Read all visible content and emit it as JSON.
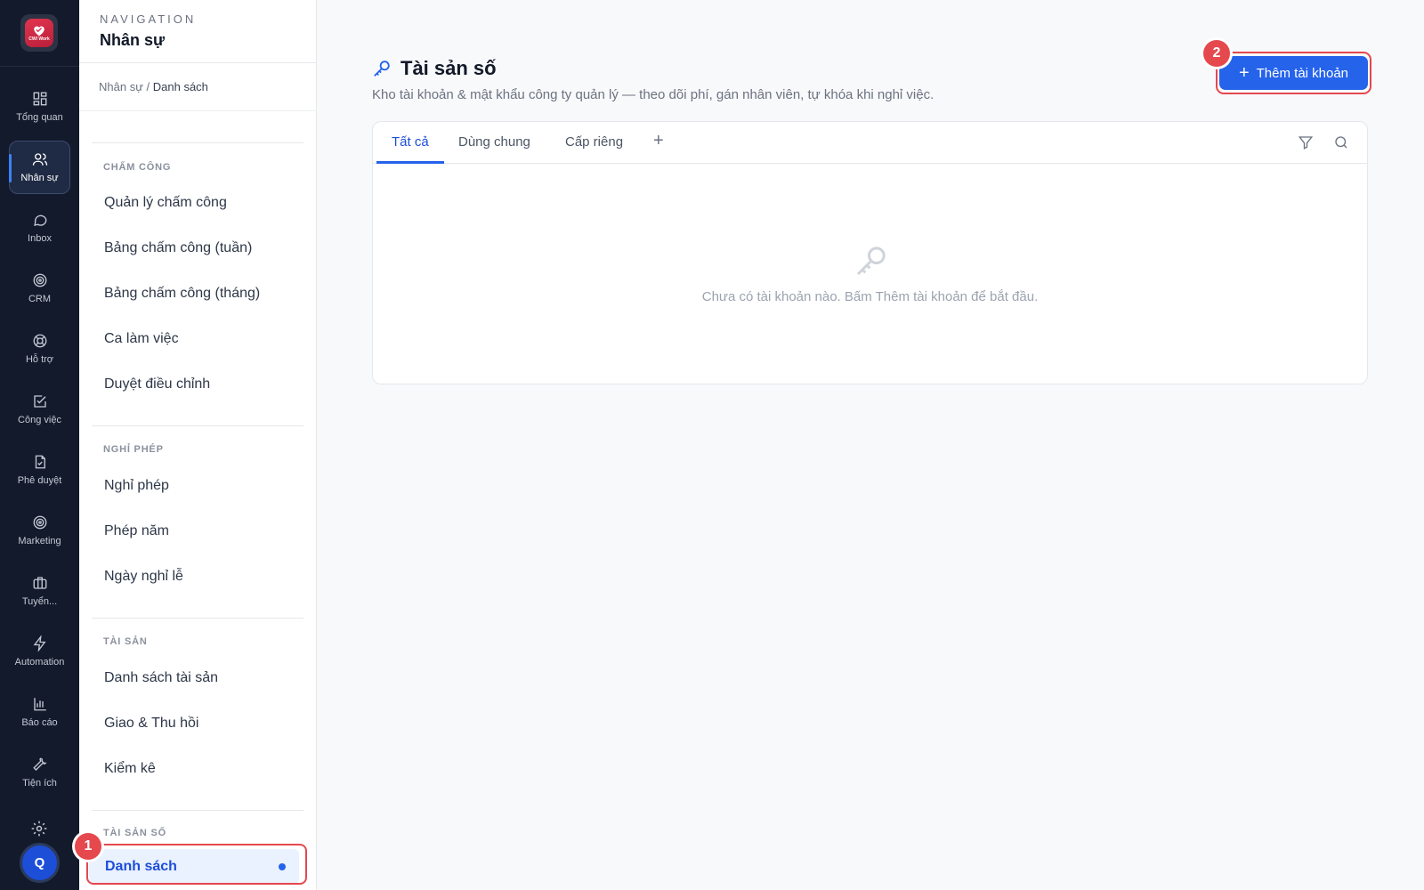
{
  "rail": {
    "logo_text": "CWI Work",
    "items": [
      {
        "label": "Tổng quan",
        "icon": "dashboard-icon"
      },
      {
        "label": "Nhân sự",
        "icon": "users-icon"
      },
      {
        "label": "Inbox",
        "icon": "chat-icon"
      },
      {
        "label": "CRM",
        "icon": "target-icon"
      },
      {
        "label": "Hỗ trợ",
        "icon": "lifebuoy-icon"
      },
      {
        "label": "Công việc",
        "icon": "checkbox-icon"
      },
      {
        "label": "Phê duyệt",
        "icon": "file-approve-icon"
      },
      {
        "label": "Marketing",
        "icon": "target-icon"
      },
      {
        "label": "Tuyển...",
        "icon": "briefcase-icon"
      },
      {
        "label": "Automation",
        "icon": "bolt-icon"
      },
      {
        "label": "Báo cáo",
        "icon": "bar-chart-icon"
      },
      {
        "label": "Tiện ích",
        "icon": "wrench-icon"
      }
    ],
    "avatar_initial": "Q"
  },
  "nav": {
    "overline": "NAVIGATION",
    "title": "Nhân sự",
    "breadcrumb": {
      "parent": "Nhân sự /",
      "current": "Danh sách"
    },
    "sections": [
      {
        "title": "CHẤM CÔNG",
        "items": [
          "Quản lý chấm công",
          "Bảng chấm công (tuần)",
          "Bảng chấm công (tháng)",
          "Ca làm việc",
          "Duyệt điều chỉnh"
        ]
      },
      {
        "title": "NGHỈ PHÉP",
        "items": [
          "Nghỉ phép",
          "Phép năm",
          "Ngày nghỉ lễ"
        ]
      },
      {
        "title": "TÀI SẢN",
        "items": [
          "Danh sách tài sản",
          "Giao & Thu hồi",
          "Kiểm kê"
        ]
      },
      {
        "title": "TÀI SẢN SỐ",
        "items": [
          "Danh sách"
        ]
      }
    ]
  },
  "badges": {
    "one": "1",
    "two": "2"
  },
  "main": {
    "title": "Tài sản số",
    "subtitle": "Kho tài khoản & mật khẩu công ty quản lý — theo dõi phí, gán nhân viên, tự khóa khi nghỉ việc.",
    "add_button": "Thêm tài khoản",
    "tabs": [
      "Tất cả",
      "Dùng chung",
      "Cấp riêng"
    ],
    "tab_add": "+",
    "empty_text": "Chưa có tài khoản nào. Bấm Thêm tài khoản để bắt đầu."
  },
  "colors": {
    "accent": "#2563eb",
    "rail_bg": "#131a2b",
    "highlight": "#e5484d"
  }
}
